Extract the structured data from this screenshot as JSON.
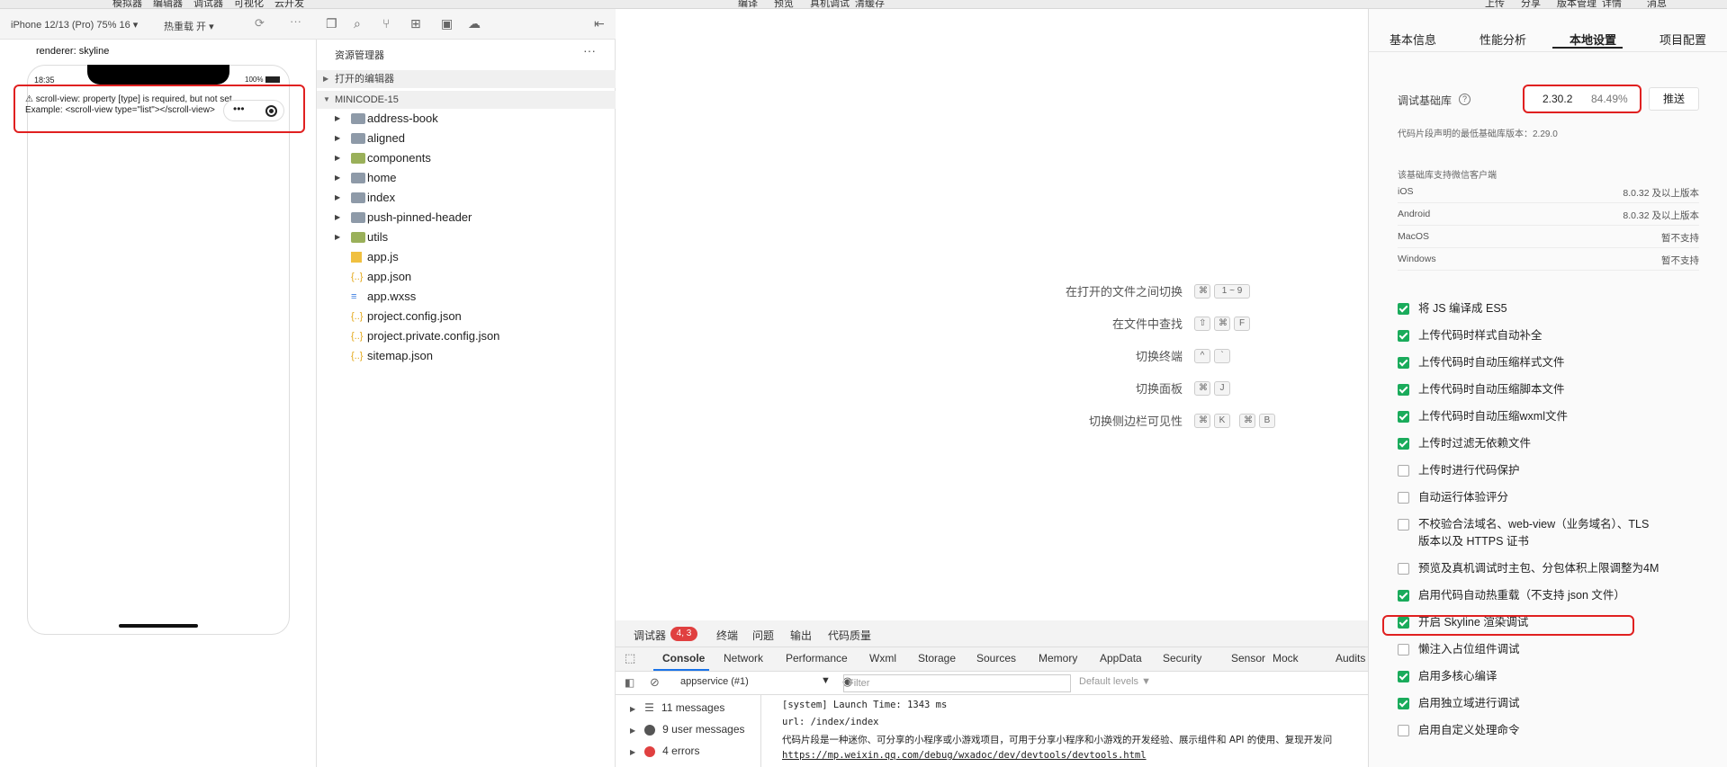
{
  "top_menu": [
    "模拟器",
    "编辑器",
    "调试器",
    "可视化",
    "云开发",
    "编译",
    "预览",
    "真机调试",
    "清缓存",
    "上传",
    "分享",
    "版本管理",
    "详情",
    "消息"
  ],
  "simulator": {
    "device": "iPhone 12/13 (Pro) 75% 16 ▾",
    "hot_reload": "热重载 开 ▾",
    "renderer": "renderer: skyline",
    "time": "18:35",
    "battery": "100%",
    "warning_line1": "⚠ scroll-view: property [type] is required, but not set.",
    "warning_line2": "Example: <scroll-view type=\"list\"></scroll-view>",
    "capsule_dots": "•••"
  },
  "explorer": {
    "title": "资源管理器",
    "more": "···",
    "section_open": "打开的编辑器",
    "section_project": "MINICODE-15",
    "items": [
      {
        "name": "address-book",
        "kind": "folder"
      },
      {
        "name": "aligned",
        "kind": "folder"
      },
      {
        "name": "components",
        "kind": "folder-g"
      },
      {
        "name": "home",
        "kind": "folder"
      },
      {
        "name": "index",
        "kind": "folder"
      },
      {
        "name": "push-pinned-header",
        "kind": "folder"
      },
      {
        "name": "utils",
        "kind": "folder-g"
      },
      {
        "name": "app.js",
        "kind": "js"
      },
      {
        "name": "app.json",
        "kind": "json"
      },
      {
        "name": "app.wxss",
        "kind": "css"
      },
      {
        "name": "project.config.json",
        "kind": "json"
      },
      {
        "name": "project.private.config.json",
        "kind": "json"
      },
      {
        "name": "sitemap.json",
        "kind": "json"
      }
    ]
  },
  "editor": {
    "shortcuts": [
      {
        "label": "在打开的文件之间切换",
        "keys": [
          "⌘",
          "1 ~ 9"
        ]
      },
      {
        "label": "在文件中查找",
        "keys": [
          "⇧",
          "⌘",
          "F"
        ]
      },
      {
        "label": "切换终端",
        "keys": [
          "^",
          "`"
        ]
      },
      {
        "label": "切换面板",
        "keys": [
          "⌘",
          "J"
        ]
      },
      {
        "label": "切换侧边栏可见性",
        "keys": [
          "⌘",
          "K",
          "⌘",
          "B"
        ]
      }
    ]
  },
  "debugger": {
    "tab_debugger": "调试器",
    "badge": "4, 3",
    "tab_terminal": "终端",
    "tab_problems": "问题",
    "tab_output": "输出",
    "tab_quality": "代码质量",
    "devtools_tabs": [
      "Console",
      "Network",
      "Performance",
      "Wxml",
      "Storage",
      "Sources",
      "Memory",
      "AppData",
      "Security",
      "Sensor",
      "Mock",
      "Audits"
    ],
    "context": "appservice (#1)",
    "filter_placeholder": "Filter",
    "levels": "Default levels ▼",
    "side": {
      "messages": "11 messages",
      "user_messages": "9 user messages",
      "errors": "4 errors"
    },
    "log_lines": [
      "[system] Launch Time: 1343 ms",
      "url: /index/index",
      "代码片段是一种迷你、可分享的小程序或小游戏项目，可用于分享小程序和小游戏的开发经验、展示组件和 API 的使用、复现开发问",
      "https://mp.weixin.qq.com/debug/wxadoc/dev/devtools/devtools.html"
    ]
  },
  "settings": {
    "tabs": [
      "基本信息",
      "性能分析",
      "本地设置",
      "项目配置"
    ],
    "active_tab": "本地设置",
    "lib_label": "调试基础库",
    "lib_help": "?",
    "lib_version": "2.30.2",
    "lib_percent": "84.49%",
    "push_label": "推送",
    "min_version": "代码片段声明的最低基础库版本：2.29.0",
    "support_title": "该基础库支持微信客户端",
    "platforms": [
      {
        "name": "iOS",
        "value": "8.0.32 及以上版本"
      },
      {
        "name": "Android",
        "value": "8.0.32 及以上版本"
      },
      {
        "name": "MacOS",
        "value": "暂不支持"
      },
      {
        "name": "Windows",
        "value": "暂不支持"
      }
    ],
    "options": [
      {
        "label": "将 JS 编译成 ES5",
        "checked": true
      },
      {
        "label": "上传代码时样式自动补全",
        "checked": true
      },
      {
        "label": "上传代码时自动压缩样式文件",
        "checked": true
      },
      {
        "label": "上传代码时自动压缩脚本文件",
        "checked": true
      },
      {
        "label": "上传代码时自动压缩wxml文件",
        "checked": true
      },
      {
        "label": "上传时过滤无依赖文件",
        "checked": true
      },
      {
        "label": "上传时进行代码保护",
        "checked": false
      },
      {
        "label": "自动运行体验评分",
        "checked": false
      },
      {
        "label": "不校验合法域名、web-view（业务域名）、TLS",
        "label2": "版本以及 HTTPS 证书",
        "checked": false
      },
      {
        "label": "预览及真机调试时主包、分包体积上限调整为4M",
        "checked": false
      },
      {
        "label": "启用代码自动热重载（不支持 json 文件）",
        "checked": true
      },
      {
        "label": "开启 Skyline 渲染调试",
        "checked": true
      },
      {
        "label": "懒注入占位组件调试",
        "checked": false
      },
      {
        "label": "启用多核心编译",
        "checked": true
      },
      {
        "label": "启用独立域进行调试",
        "checked": true
      },
      {
        "label": "启用自定义处理命令",
        "checked": false
      }
    ]
  },
  "colors": {
    "accent": "#1aab5b",
    "highlight": "#e02020",
    "badge": "#e04040",
    "active_tab_line": "#1a73e8"
  }
}
